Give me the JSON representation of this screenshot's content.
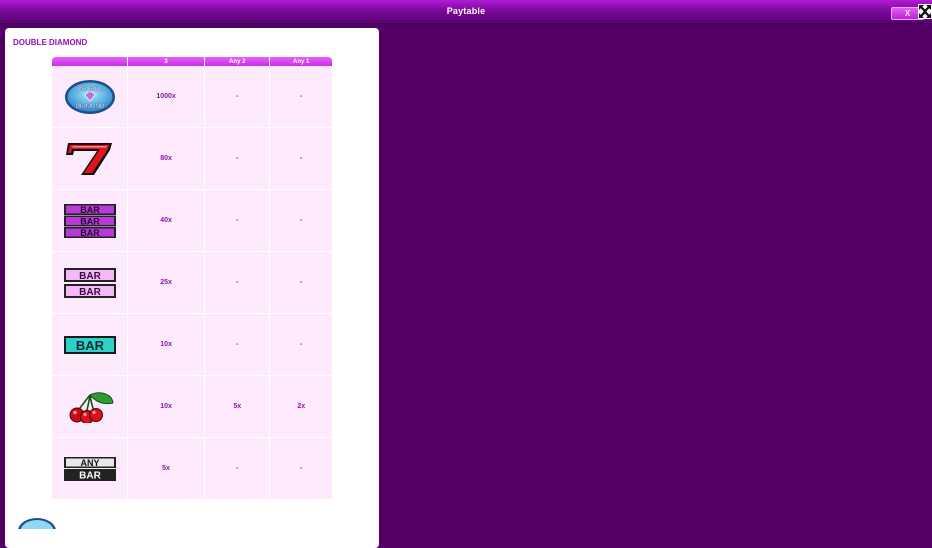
{
  "window": {
    "title": "Paytable",
    "close_label": "X"
  },
  "game": {
    "title": "DOUBLE DIAMOND"
  },
  "paytable": {
    "headers": [
      "",
      "3",
      "Any 2",
      "Any 1"
    ],
    "rows": [
      {
        "symbol": "double-diamond-logo",
        "pay3": "1000x",
        "any2": "-",
        "any1": "-"
      },
      {
        "symbol": "red-seven",
        "pay3": "80x",
        "any2": "-",
        "any1": "-"
      },
      {
        "symbol": "triple-bar",
        "pay3": "40x",
        "any2": "-",
        "any1": "-"
      },
      {
        "symbol": "double-bar",
        "pay3": "25x",
        "any2": "-",
        "any1": "-"
      },
      {
        "symbol": "single-bar",
        "pay3": "10x",
        "any2": "-",
        "any1": "-"
      },
      {
        "symbol": "cherries",
        "pay3": "10x",
        "any2": "5x",
        "any1": "2x"
      },
      {
        "symbol": "any-bar",
        "pay3": "5x",
        "any2": "-",
        "any1": "-"
      }
    ]
  },
  "symbol_text": {
    "logo_line1": "DOUBLE",
    "logo_line2": "DIAMOND",
    "bar": "BAR",
    "any": "ANY"
  },
  "colors": {
    "background": "#520066",
    "accent": "#c82fe8",
    "cell_bg": "#fdeafd",
    "text": "#8a1aa2"
  }
}
